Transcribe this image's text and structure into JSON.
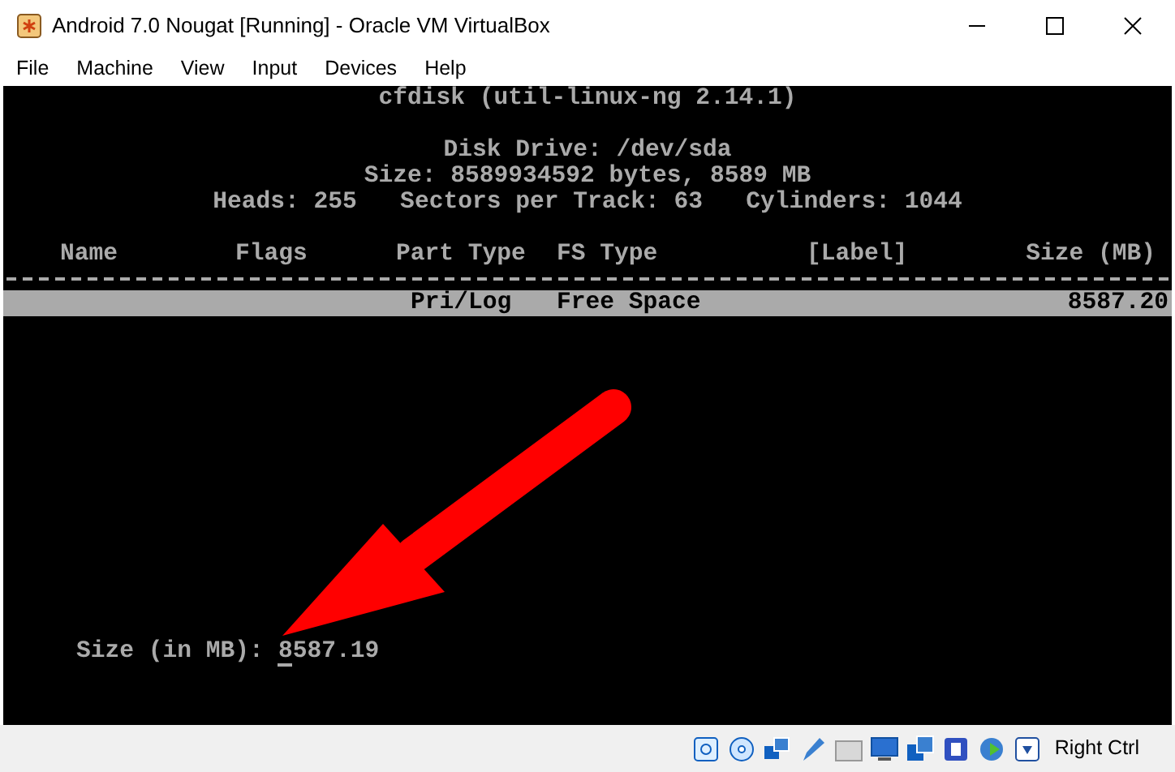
{
  "window": {
    "title": "Android 7.0 Nougat [Running] - Oracle VM VirtualBox"
  },
  "menu": [
    "File",
    "Machine",
    "View",
    "Input",
    "Devices",
    "Help"
  ],
  "terminal": {
    "title": "cfdisk (util-linux-ng 2.14.1)",
    "info": [
      "Disk Drive: /dev/sda",
      "Size: 8589934592 bytes, 8589 MB",
      "Heads: 255   Sectors per Track: 63   Cylinders: 1044"
    ],
    "columns": [
      "Name",
      "Flags",
      "Part Type",
      "FS Type",
      "[Label]",
      "Size (MB)"
    ],
    "rows": [
      {
        "part_type": "Pri/Log",
        "fs_type": "Free Space",
        "size": "8587.20",
        "selected": true
      }
    ],
    "prompt": {
      "label": "Size (in MB):",
      "value": "8587.19"
    }
  },
  "status_bar": {
    "host_key": "Right Ctrl"
  }
}
